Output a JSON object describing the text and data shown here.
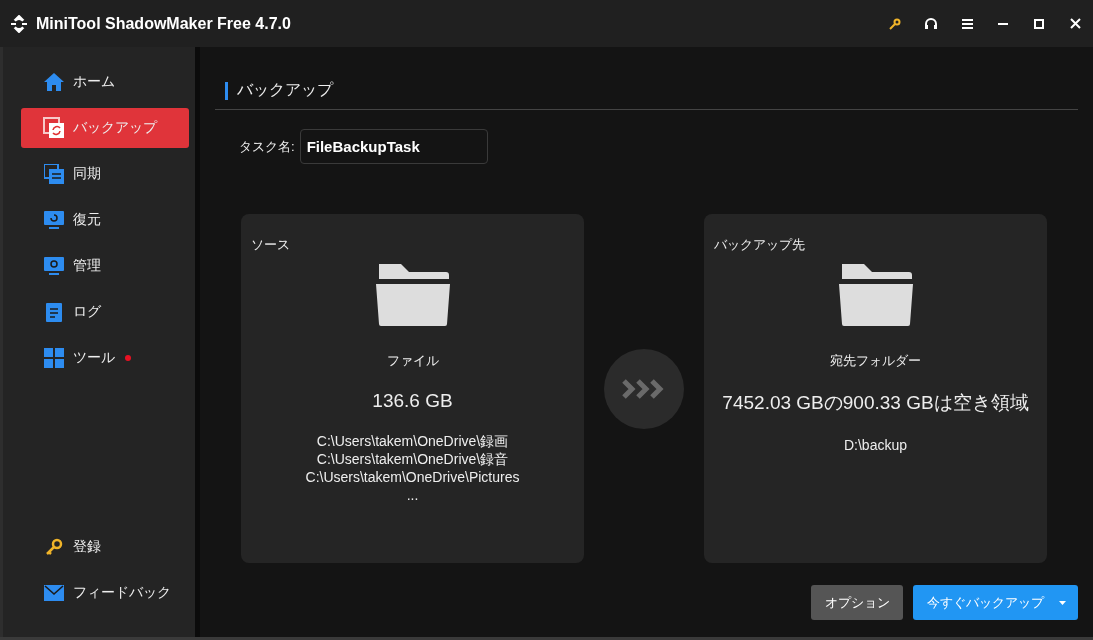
{
  "window": {
    "title": "MiniTool ShadowMaker Free 4.7.0"
  },
  "sidebar": {
    "items": [
      {
        "label": "ホーム",
        "selected": false,
        "has_notification": false
      },
      {
        "label": "バックアップ",
        "selected": true,
        "has_notification": false
      },
      {
        "label": "同期",
        "selected": false,
        "has_notification": false
      },
      {
        "label": "復元",
        "selected": false,
        "has_notification": false
      },
      {
        "label": "管理",
        "selected": false,
        "has_notification": false
      },
      {
        "label": "ログ",
        "selected": false,
        "has_notification": false
      },
      {
        "label": "ツール",
        "selected": false,
        "has_notification": true
      }
    ],
    "bottom_items": [
      {
        "label": "登録"
      },
      {
        "label": "フィードバック"
      }
    ]
  },
  "page": {
    "title": "バックアップ",
    "task_name_label": "タスク名:",
    "task_name_value": "FileBackupTask",
    "source": {
      "heading": "ソース",
      "type": "ファイル",
      "size": "136.6 GB",
      "paths": [
        "C:\\Users\\takem\\OneDrive\\録画",
        "C:\\Users\\takem\\OneDrive\\録音",
        "C:\\Users\\takem\\OneDrive\\Pictures",
        "..."
      ]
    },
    "destination": {
      "heading": "バックアップ先",
      "type": "宛先フォルダー",
      "size": "7452.03 GBの900.33 GBは空き領域",
      "paths": [
        "D:\\backup"
      ]
    },
    "buttons": {
      "options": "オプション",
      "backup_now": "今すぐバックアップ"
    }
  }
}
